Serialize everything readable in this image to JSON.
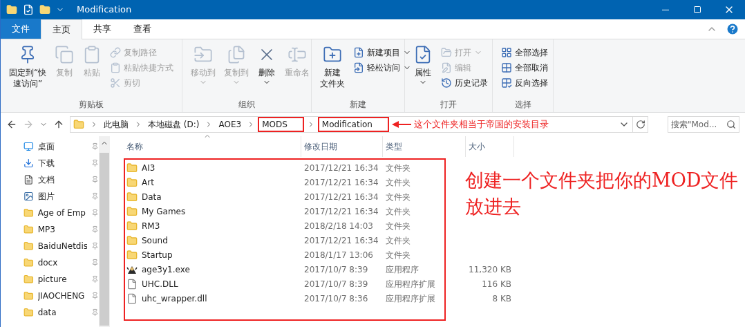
{
  "window": {
    "title": "Modification"
  },
  "tabs": [
    {
      "label": "文件",
      "kind": "file",
      "selected": false
    },
    {
      "label": "主页",
      "kind": "tab",
      "selected": true
    },
    {
      "label": "共享",
      "kind": "tab",
      "selected": false
    },
    {
      "label": "查看",
      "kind": "tab",
      "selected": false
    }
  ],
  "ribbon": {
    "groups": [
      {
        "label": "剪贴板",
        "items": [
          {
            "kind": "large",
            "label": [
              "固定到“快",
              "速访问”"
            ],
            "disabled": false,
            "dropdown": false
          },
          {
            "kind": "large",
            "label": [
              "复制"
            ],
            "disabled": true,
            "dropdown": false
          },
          {
            "kind": "large",
            "label": [
              "粘贴"
            ],
            "disabled": true,
            "dropdown": false
          },
          {
            "kind": "small",
            "label": "复制路径",
            "disabled": true,
            "dropdown": false
          },
          {
            "kind": "small",
            "label": "粘贴快捷方式",
            "disabled": true,
            "dropdown": false
          },
          {
            "kind": "small",
            "label": "剪切",
            "disabled": true,
            "dropdown": false
          }
        ]
      },
      {
        "label": "组织",
        "items": [
          {
            "kind": "large",
            "label": [
              "移动到"
            ],
            "disabled": true,
            "dropdown": true
          },
          {
            "kind": "large",
            "label": [
              "复制到"
            ],
            "disabled": true,
            "dropdown": true
          },
          {
            "kind": "large",
            "label": [
              "删除"
            ],
            "disabled": false,
            "dropdown": true
          },
          {
            "kind": "large",
            "label": [
              "重命名"
            ],
            "disabled": true,
            "dropdown": false
          }
        ]
      },
      {
        "label": "新建",
        "items": [
          {
            "kind": "large",
            "label": [
              "新建",
              "文件夹"
            ],
            "disabled": false,
            "dropdown": false
          },
          {
            "kind": "small",
            "label": "新建项目",
            "disabled": false,
            "dropdown": true
          },
          {
            "kind": "small",
            "label": "轻松访问",
            "disabled": false,
            "dropdown": true
          }
        ]
      },
      {
        "label": "打开",
        "items": [
          {
            "kind": "large",
            "label": [
              "属性"
            ],
            "disabled": false,
            "dropdown": true
          },
          {
            "kind": "small",
            "label": "打开",
            "disabled": true,
            "dropdown": true
          },
          {
            "kind": "small",
            "label": "编辑",
            "disabled": true,
            "dropdown": false
          },
          {
            "kind": "small",
            "label": "历史记录",
            "disabled": false,
            "dropdown": false
          }
        ]
      },
      {
        "label": "选择",
        "items": [
          {
            "kind": "small",
            "label": "全部选择",
            "disabled": false,
            "dropdown": false
          },
          {
            "kind": "small",
            "label": "全部取消",
            "disabled": false,
            "dropdown": false
          },
          {
            "kind": "small",
            "label": "反向选择",
            "disabled": false,
            "dropdown": false
          }
        ]
      }
    ]
  },
  "address": {
    "crumbs": [
      {
        "label": "此电脑",
        "highlighted": false
      },
      {
        "label": "本地磁盘 (D:)",
        "highlighted": false
      },
      {
        "label": "AOE3",
        "highlighted": false
      },
      {
        "label": "MODS",
        "highlighted": true
      },
      {
        "label": "Modification",
        "highlighted": true
      }
    ],
    "note": "这个文件夹相当于帝国的安装目录"
  },
  "search": {
    "placeholder": "搜索\"Mod..."
  },
  "sidebar": {
    "items": [
      {
        "label": "桌面",
        "kind": "desktop"
      },
      {
        "label": "下载",
        "kind": "download"
      },
      {
        "label": "文档",
        "kind": "document"
      },
      {
        "label": "图片",
        "kind": "pictures"
      },
      {
        "label": "Age of Emp",
        "kind": "folder"
      },
      {
        "label": "MP3",
        "kind": "folder"
      },
      {
        "label": "BaiduNetdis",
        "kind": "folder"
      },
      {
        "label": "docx",
        "kind": "folder"
      },
      {
        "label": "picture",
        "kind": "folder"
      },
      {
        "label": "JIAOCHENG",
        "kind": "folder"
      },
      {
        "label": "data",
        "kind": "folder"
      }
    ]
  },
  "table": {
    "columns": [
      "名称",
      "修改日期",
      "类型",
      "大小"
    ],
    "rows": [
      {
        "name": "AI3",
        "date": "2017/12/21 16:34",
        "type": "文件夹",
        "kind": "folder"
      },
      {
        "name": "Art",
        "date": "2017/12/21 16:34",
        "type": "文件夹",
        "kind": "folder"
      },
      {
        "name": "Data",
        "date": "2017/12/21 16:34",
        "type": "文件夹",
        "kind": "folder"
      },
      {
        "name": "My Games",
        "date": "2017/12/21 16:34",
        "type": "文件夹",
        "kind": "folder"
      },
      {
        "name": "RM3",
        "date": "2018/2/18 14:03",
        "type": "文件夹",
        "kind": "folder"
      },
      {
        "name": "Sound",
        "date": "2017/12/21 16:34",
        "type": "文件夹",
        "kind": "folder"
      },
      {
        "name": "Startup",
        "date": "2018/1/17 13:06",
        "type": "文件夹",
        "kind": "folder"
      },
      {
        "name": "age3y1.exe",
        "date": "2017/10/7 8:39",
        "type": "应用程序",
        "size": "11,320 KB",
        "kind": "exe"
      },
      {
        "name": "UHC.DLL",
        "date": "2017/10/7 8:39",
        "type": "应用程序扩展",
        "size": "116 KB",
        "kind": "dll"
      },
      {
        "name": "uhc_wrapper.dll",
        "date": "2017/10/7 8:36",
        "type": "应用程序扩展",
        "size": "8 KB",
        "kind": "dll"
      }
    ]
  },
  "annotation": {
    "text": "创建一个文件夹把你的MOD文件放进去"
  }
}
